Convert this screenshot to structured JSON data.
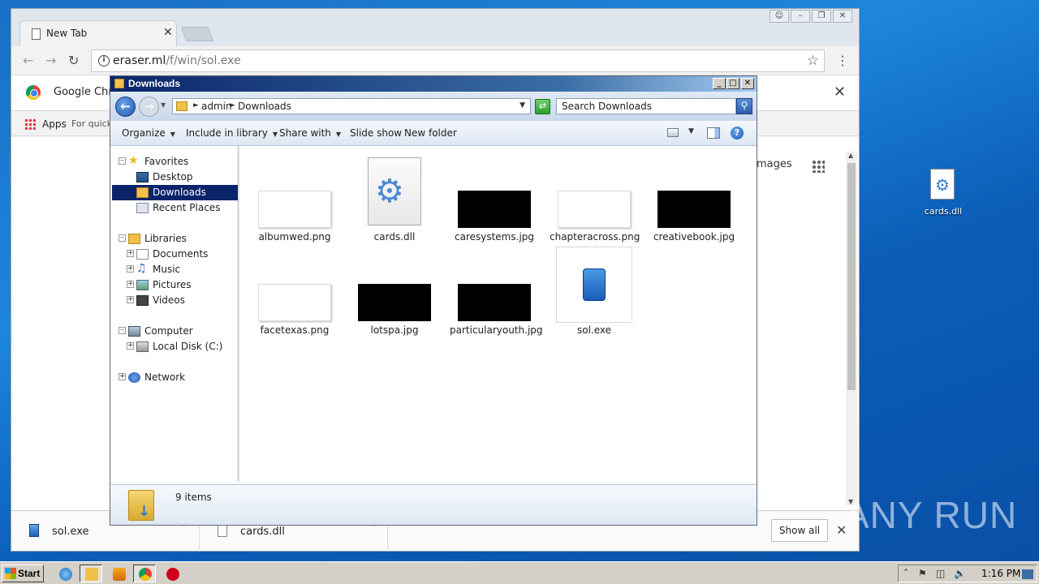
{
  "chrome": {
    "tab_title": "New Tab",
    "url_host": "eraser.ml",
    "url_path": "/f/win/sol.exe",
    "infobar_text": "Google Chro",
    "bookmarks": {
      "apps": "Apps",
      "quick": "For quick"
    },
    "content_images": "mages",
    "downloads": [
      {
        "name": "sol.exe",
        "icon": "exe-icon"
      },
      {
        "name": "cards.dll",
        "icon": "dll-icon"
      }
    ],
    "show_all": "Show all"
  },
  "explorer": {
    "title": "Downloads",
    "breadcrumb": [
      "admin",
      "Downloads"
    ],
    "search_placeholder": "Search Downloads",
    "commands": {
      "organize": "Organize",
      "include_in_library": "Include in library",
      "share_with": "Share with",
      "slide_show": "Slide show",
      "new_folder": "New folder"
    },
    "nav": {
      "favorites": "Favorites",
      "desktop": "Desktop",
      "downloads": "Downloads",
      "recent_places": "Recent Places",
      "libraries": "Libraries",
      "documents": "Documents",
      "music": "Music",
      "pictures": "Pictures",
      "videos": "Videos",
      "computer": "Computer",
      "local_disk": "Local Disk (C:)",
      "network": "Network"
    },
    "files": [
      {
        "name": "albumwed.png",
        "kind": "white"
      },
      {
        "name": "cards.dll",
        "kind": "dll"
      },
      {
        "name": "caresystems.jpg",
        "kind": "black"
      },
      {
        "name": "chapteracross.png",
        "kind": "white"
      },
      {
        "name": "creativebook.jpg",
        "kind": "black"
      },
      {
        "name": "facetexas.png",
        "kind": "white"
      },
      {
        "name": "lotspa.jpg",
        "kind": "black"
      },
      {
        "name": "particularyouth.jpg",
        "kind": "black"
      },
      {
        "name": "sol.exe",
        "kind": "exe"
      }
    ],
    "status": "9 items"
  },
  "desktop": {
    "icon_label": "cards.dll",
    "watermark": "ANY RUN"
  },
  "taskbar": {
    "start": "Start",
    "time": "1:16 PM"
  }
}
